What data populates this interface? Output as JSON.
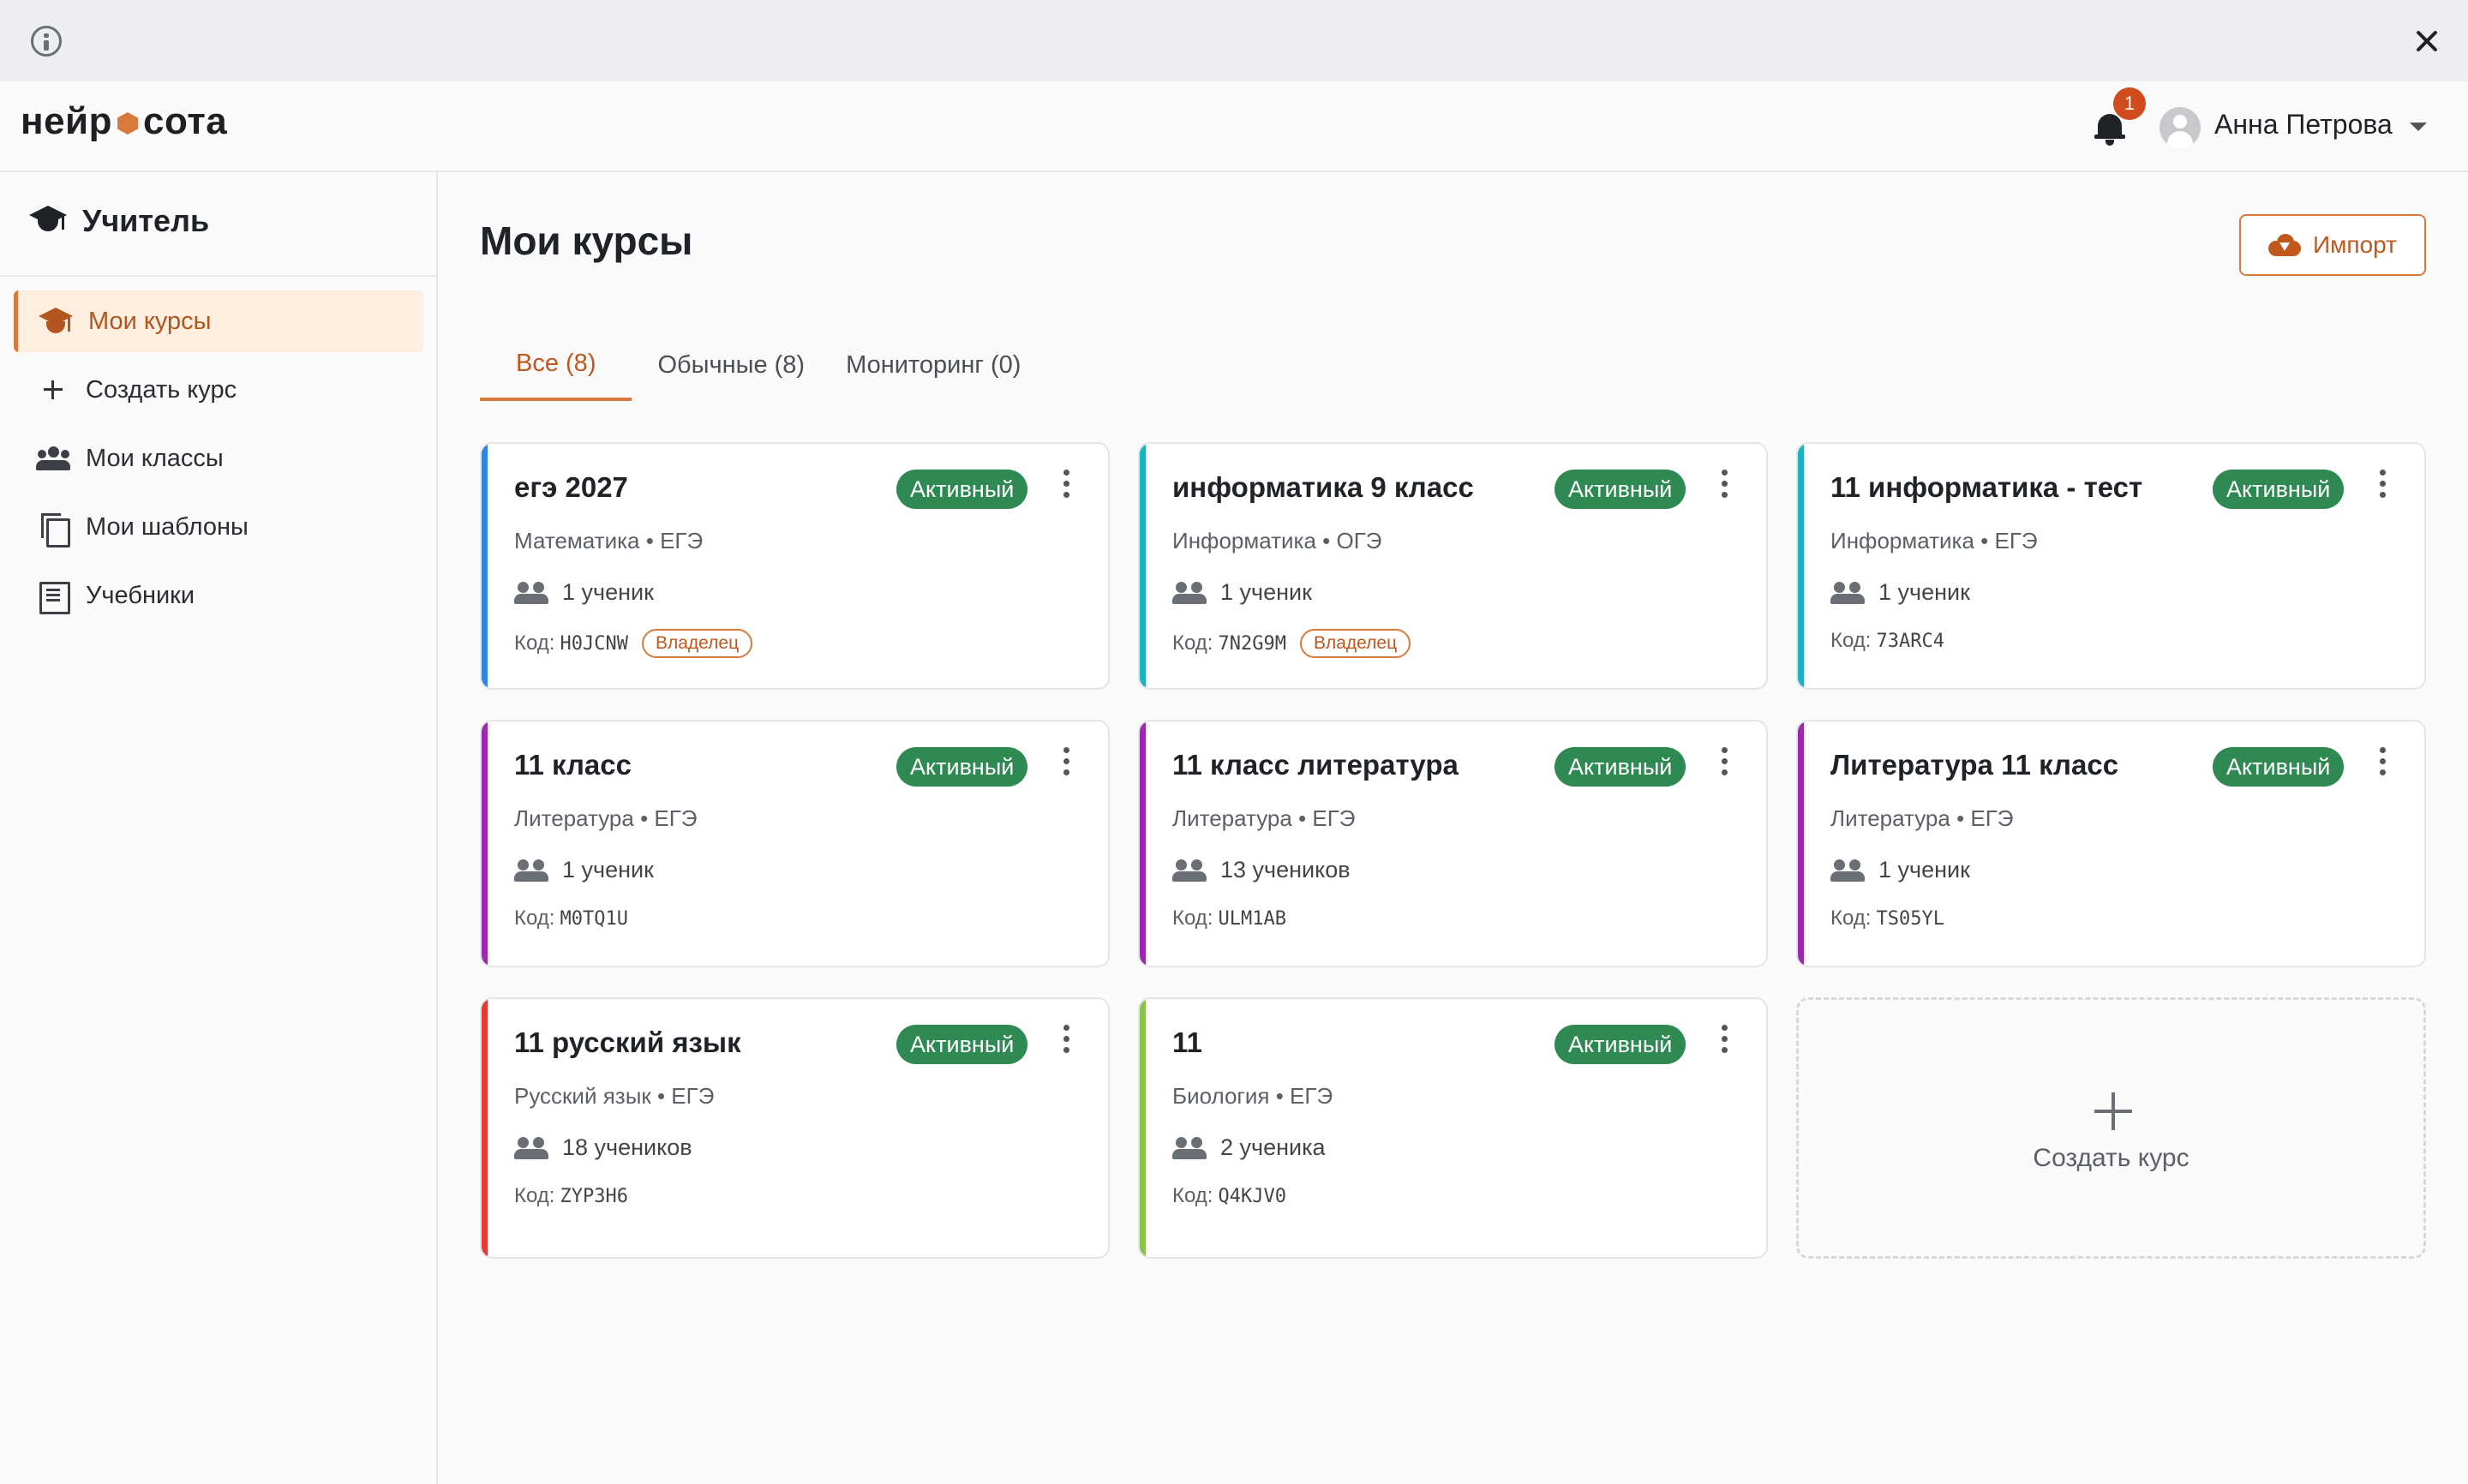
{
  "header": {
    "logo_left": "нейр",
    "logo_right": "сота",
    "notification_count": "1",
    "user_name": "Анна Петрова"
  },
  "sidebar": {
    "title": "Учитель",
    "items": [
      {
        "label": "Мои курсы",
        "icon": "graduation-cap-icon",
        "active": true
      },
      {
        "label": "Создать курс",
        "icon": "plus-icon"
      },
      {
        "label": "Мои классы",
        "icon": "people-icon"
      },
      {
        "label": "Мои шаблоны",
        "icon": "copy-icon"
      },
      {
        "label": "Учебники",
        "icon": "book-icon"
      }
    ]
  },
  "main": {
    "title": "Мои курсы",
    "import_label": "Импорт",
    "tabs": [
      {
        "label": "Все (8)",
        "active": true
      },
      {
        "label": "Обычные (8)"
      },
      {
        "label": "Мониторинг (0)"
      }
    ],
    "code_prefix": "Код:",
    "owner_label": "Владелец",
    "status_label": "Активный",
    "courses": [
      {
        "title": "егэ 2027",
        "subject": "Математика • ЕГЭ",
        "students": "1 ученик",
        "code": "H0JCNW",
        "owner": true,
        "color": "#2f86de"
      },
      {
        "title": "информатика 9 класс",
        "subject": "Информатика • ОГЭ",
        "students": "1 ученик",
        "code": "7N2G9M",
        "owner": true,
        "color": "#19b3c4"
      },
      {
        "title": "11 информатика - тест",
        "subject": "Информатика • ЕГЭ",
        "students": "1 ученик",
        "code": "73ARC4",
        "owner": false,
        "color": "#19b3c4"
      },
      {
        "title": "11 класс",
        "subject": "Литература • ЕГЭ",
        "students": "1 ученик",
        "code": "M0TQ1U",
        "owner": false,
        "color": "#9c27b0"
      },
      {
        "title": "11 класс литература",
        "subject": "Литература • ЕГЭ",
        "students": "13 учеников",
        "code": "ULM1AB",
        "owner": false,
        "color": "#9c27b0"
      },
      {
        "title": "Литература 11 класс",
        "subject": "Литература • ЕГЭ",
        "students": "1 ученик",
        "code": "TS05YL",
        "owner": false,
        "color": "#9c27b0"
      },
      {
        "title": "11 русский язык",
        "subject": "Русский язык • ЕГЭ",
        "students": "18 учеников",
        "code": "ZYP3H6",
        "owner": false,
        "color": "#e53935"
      },
      {
        "title": "11",
        "subject": "Биология • ЕГЭ",
        "students": "2 ученика",
        "code": "Q4KJV0",
        "owner": false,
        "color": "#8bc34a"
      }
    ],
    "create_card_label": "Создать курс"
  }
}
